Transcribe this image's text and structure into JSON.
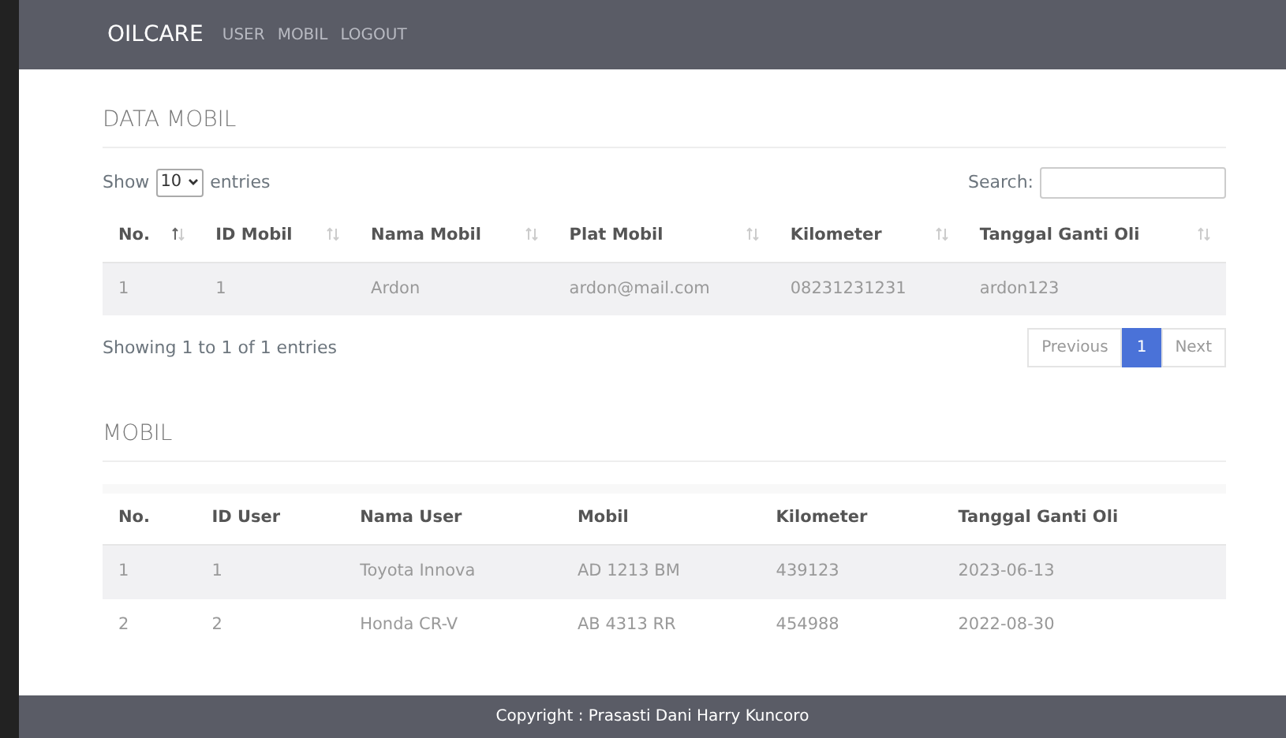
{
  "navbar": {
    "brand": "OILCARE",
    "links": [
      "USER",
      "MOBIL",
      "LOGOUT"
    ]
  },
  "data_mobil": {
    "title": "DATA MOBIL",
    "length": {
      "before": "Show",
      "value": "10",
      "after": "entries"
    },
    "search_label": "Search:",
    "columns": [
      {
        "label": "No.",
        "sorted": true
      },
      {
        "label": "ID Mobil",
        "sorted": false
      },
      {
        "label": "Nama Mobil",
        "sorted": false
      },
      {
        "label": "Plat Mobil",
        "sorted": false
      },
      {
        "label": "Kilometer",
        "sorted": false
      },
      {
        "label": "Tanggal Ganti Oli",
        "sorted": false
      }
    ],
    "rows": [
      [
        "1",
        "1",
        "Ardon",
        "ardon@mail.com",
        "08231231231",
        "ardon123"
      ]
    ],
    "info": "Showing 1 to 1 of 1 entries",
    "pagination": [
      {
        "label": "Previous",
        "selected": false
      },
      {
        "label": "1",
        "selected": true
      },
      {
        "label": "Next",
        "selected": false
      }
    ]
  },
  "mobil": {
    "title": "MOBIL",
    "columns": [
      "No.",
      "ID User",
      "Nama User",
      "Mobil",
      "Kilometer",
      "Tanggal Ganti Oli"
    ],
    "rows": [
      [
        "1",
        "1",
        "Toyota Innova",
        "AD 1213 BM",
        "439123",
        "2023-06-13"
      ],
      [
        "2",
        "2",
        "Honda CR-V",
        "AB 4313 RR",
        "454988",
        "2022-08-30"
      ]
    ]
  },
  "footer": "Copyright : Prasasti Dani Harry Kuncoro"
}
